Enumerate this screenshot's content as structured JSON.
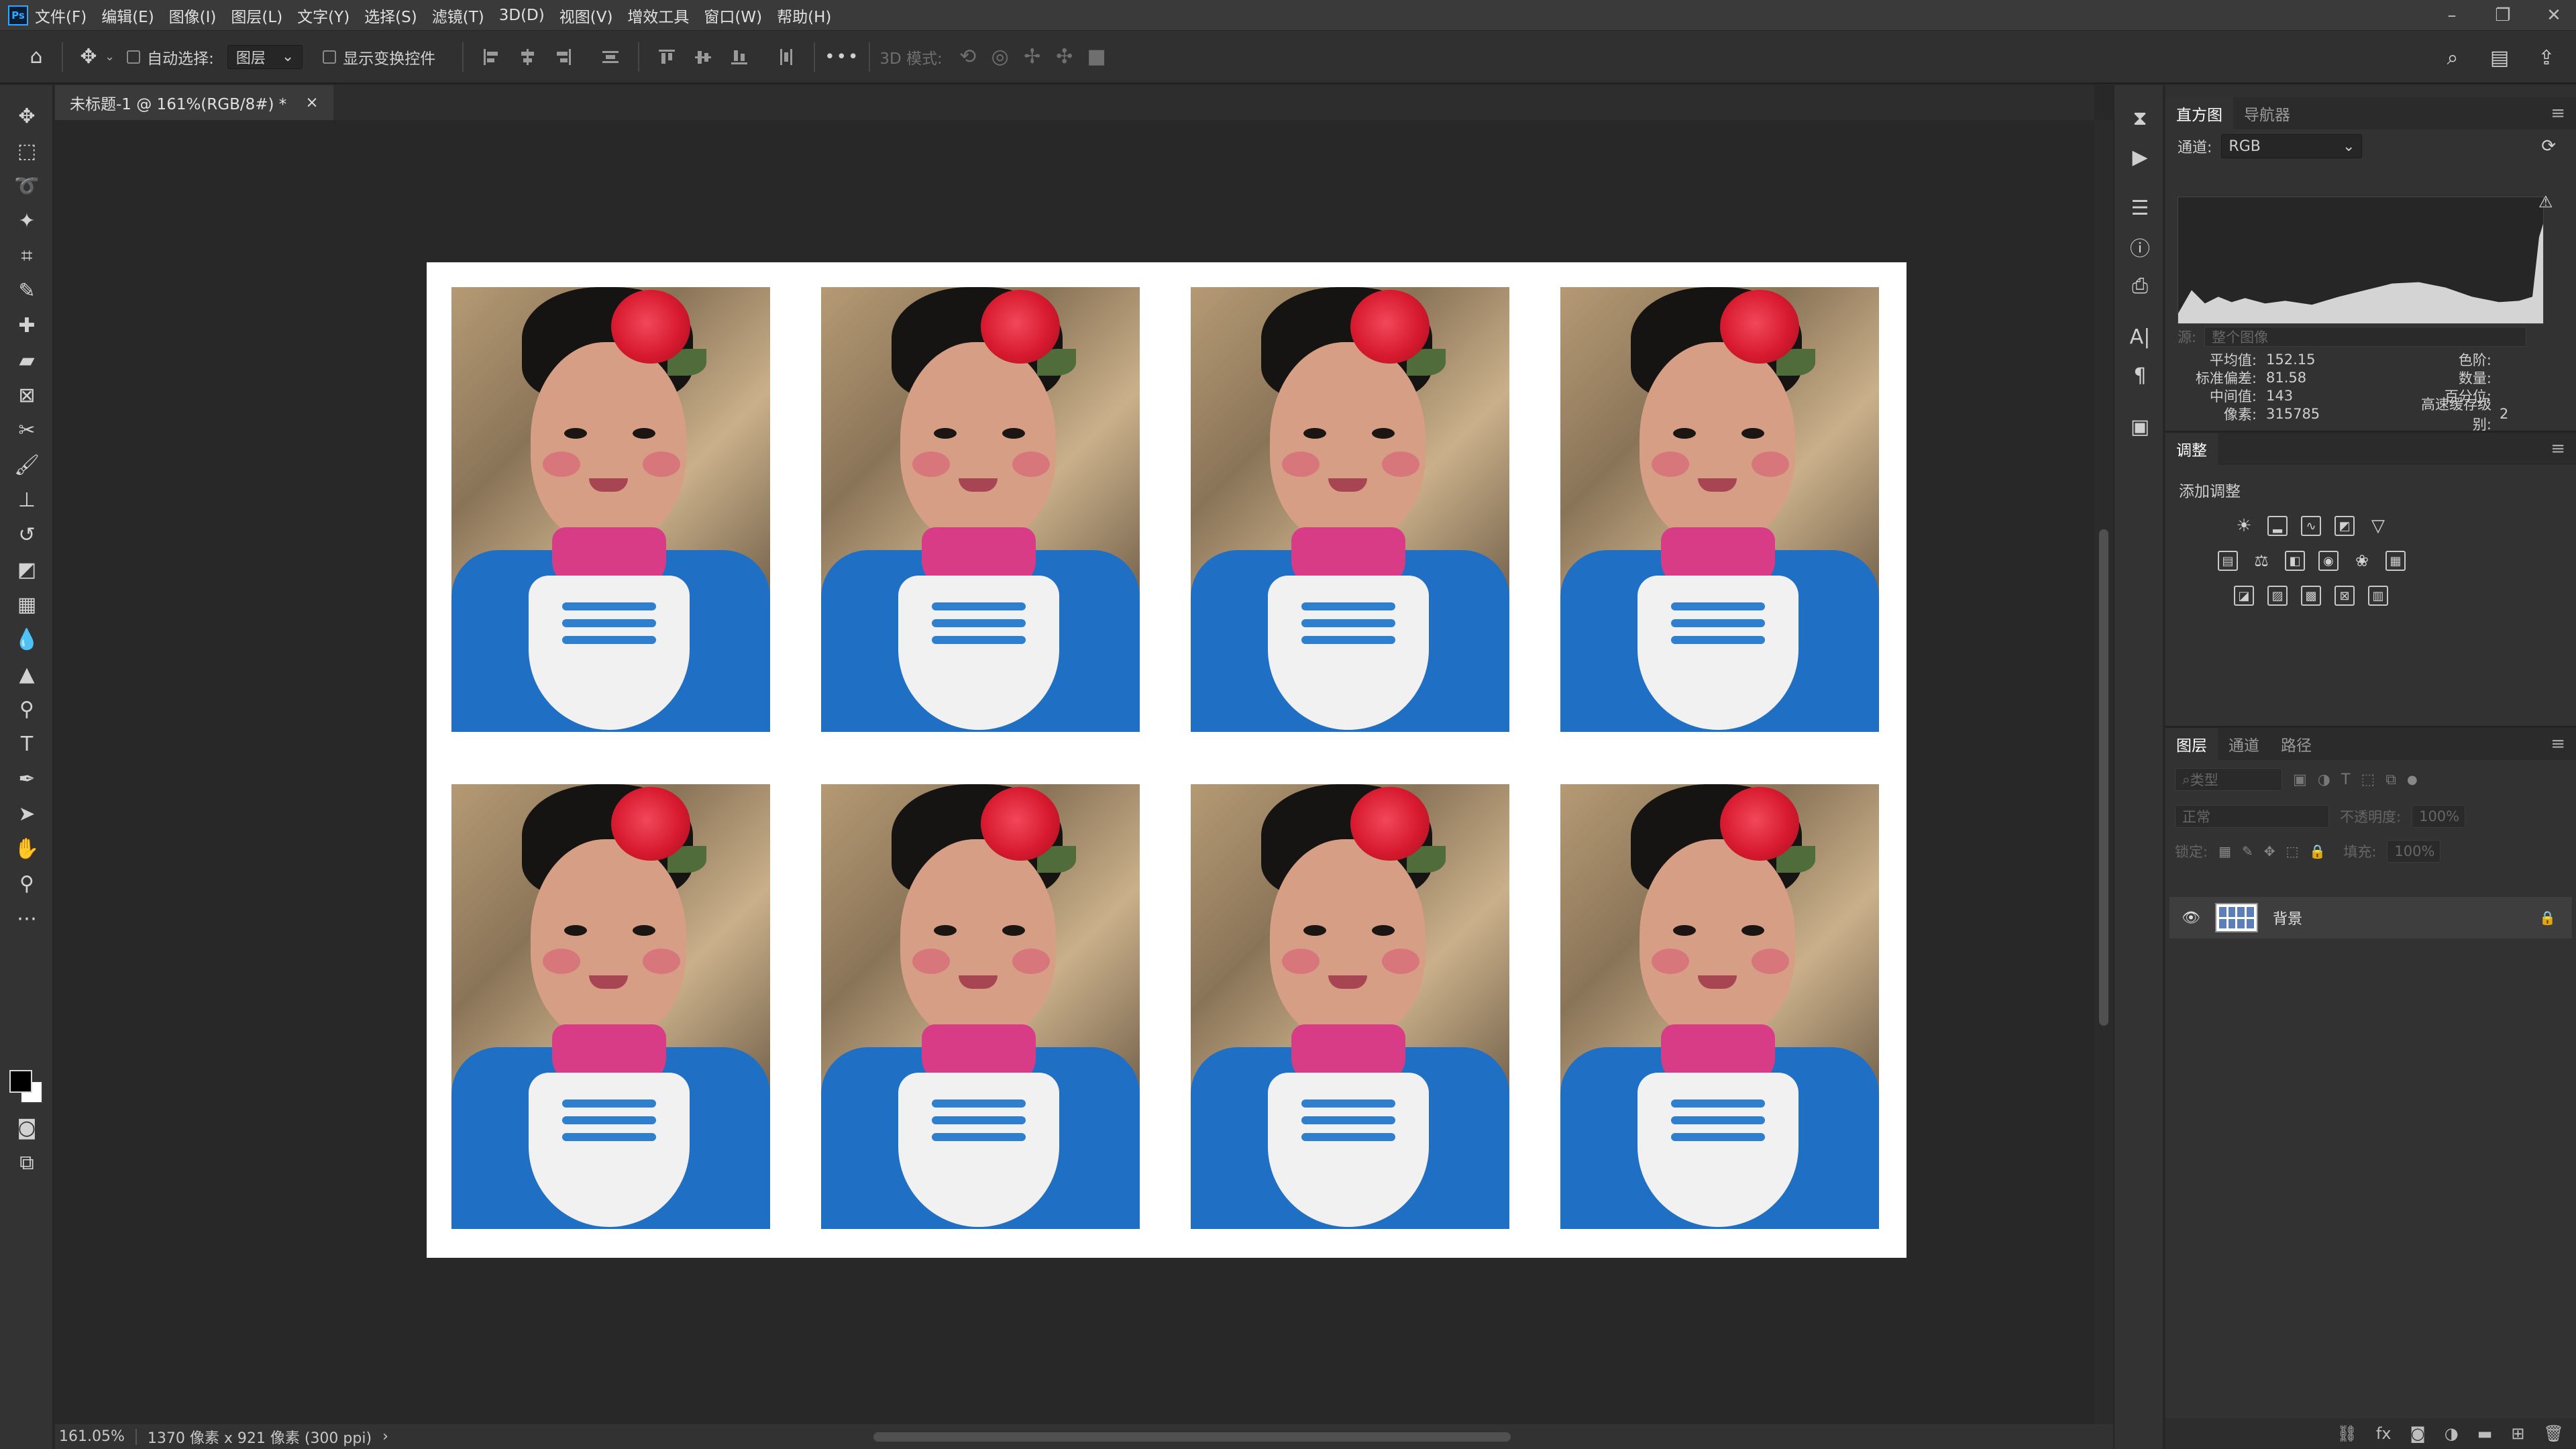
{
  "app": {
    "logo": "Ps"
  },
  "menu": [
    "文件(F)",
    "编辑(E)",
    "图像(I)",
    "图层(L)",
    "文字(Y)",
    "选择(S)",
    "滤镜(T)",
    "3D(D)",
    "视图(V)",
    "增效工具",
    "窗口(W)",
    "帮助(H)"
  ],
  "options": {
    "auto_select_label": "自动选择:",
    "auto_select_value": "图层",
    "show_transform_label": "显示变换控件",
    "more": "•••",
    "mode_3d_label": "3D 模式:"
  },
  "document": {
    "tab_title": "未标题-1 @ 161%(RGB/8#) *",
    "close": "×"
  },
  "photos": {
    "rows": 2,
    "columns": 4,
    "subject": "portrait-photo"
  },
  "status": {
    "zoom": "161.05%",
    "doc_info": "1370 像素 x 921 像素 (300 ppi)",
    "arrow": "›"
  },
  "histogram_panel": {
    "tabs": [
      "直方图",
      "导航器"
    ],
    "channel_label": "通道:",
    "channel_value": "RGB",
    "source_label": "源:",
    "source_value": "整个图像",
    "stats_left": [
      {
        "label": "平均值:",
        "value": "152.15"
      },
      {
        "label": "标准偏差:",
        "value": "81.58"
      },
      {
        "label": "中间值:",
        "value": "143"
      },
      {
        "label": "像素:",
        "value": "315785"
      }
    ],
    "stats_right": [
      {
        "label": "色阶:",
        "value": ""
      },
      {
        "label": "数量:",
        "value": ""
      },
      {
        "label": "百分位:",
        "value": ""
      },
      {
        "label": "高速缓存级别:",
        "value": "2"
      }
    ]
  },
  "adjustments_panel": {
    "tab": "调整",
    "add_label": "添加调整"
  },
  "layers_panel": {
    "tabs": [
      "图层",
      "通道",
      "路径"
    ],
    "filter_placeholder": "类型",
    "blend_mode": "正常",
    "opacity_label": "不透明度:",
    "opacity_value": "100%",
    "lock_label": "锁定:",
    "fill_label": "填充:",
    "fill_value": "100%",
    "layer_name": "背景"
  },
  "colors": {
    "accent": "#31a8ff",
    "canvas_bg": "#282828",
    "panel_bg": "#323232"
  }
}
